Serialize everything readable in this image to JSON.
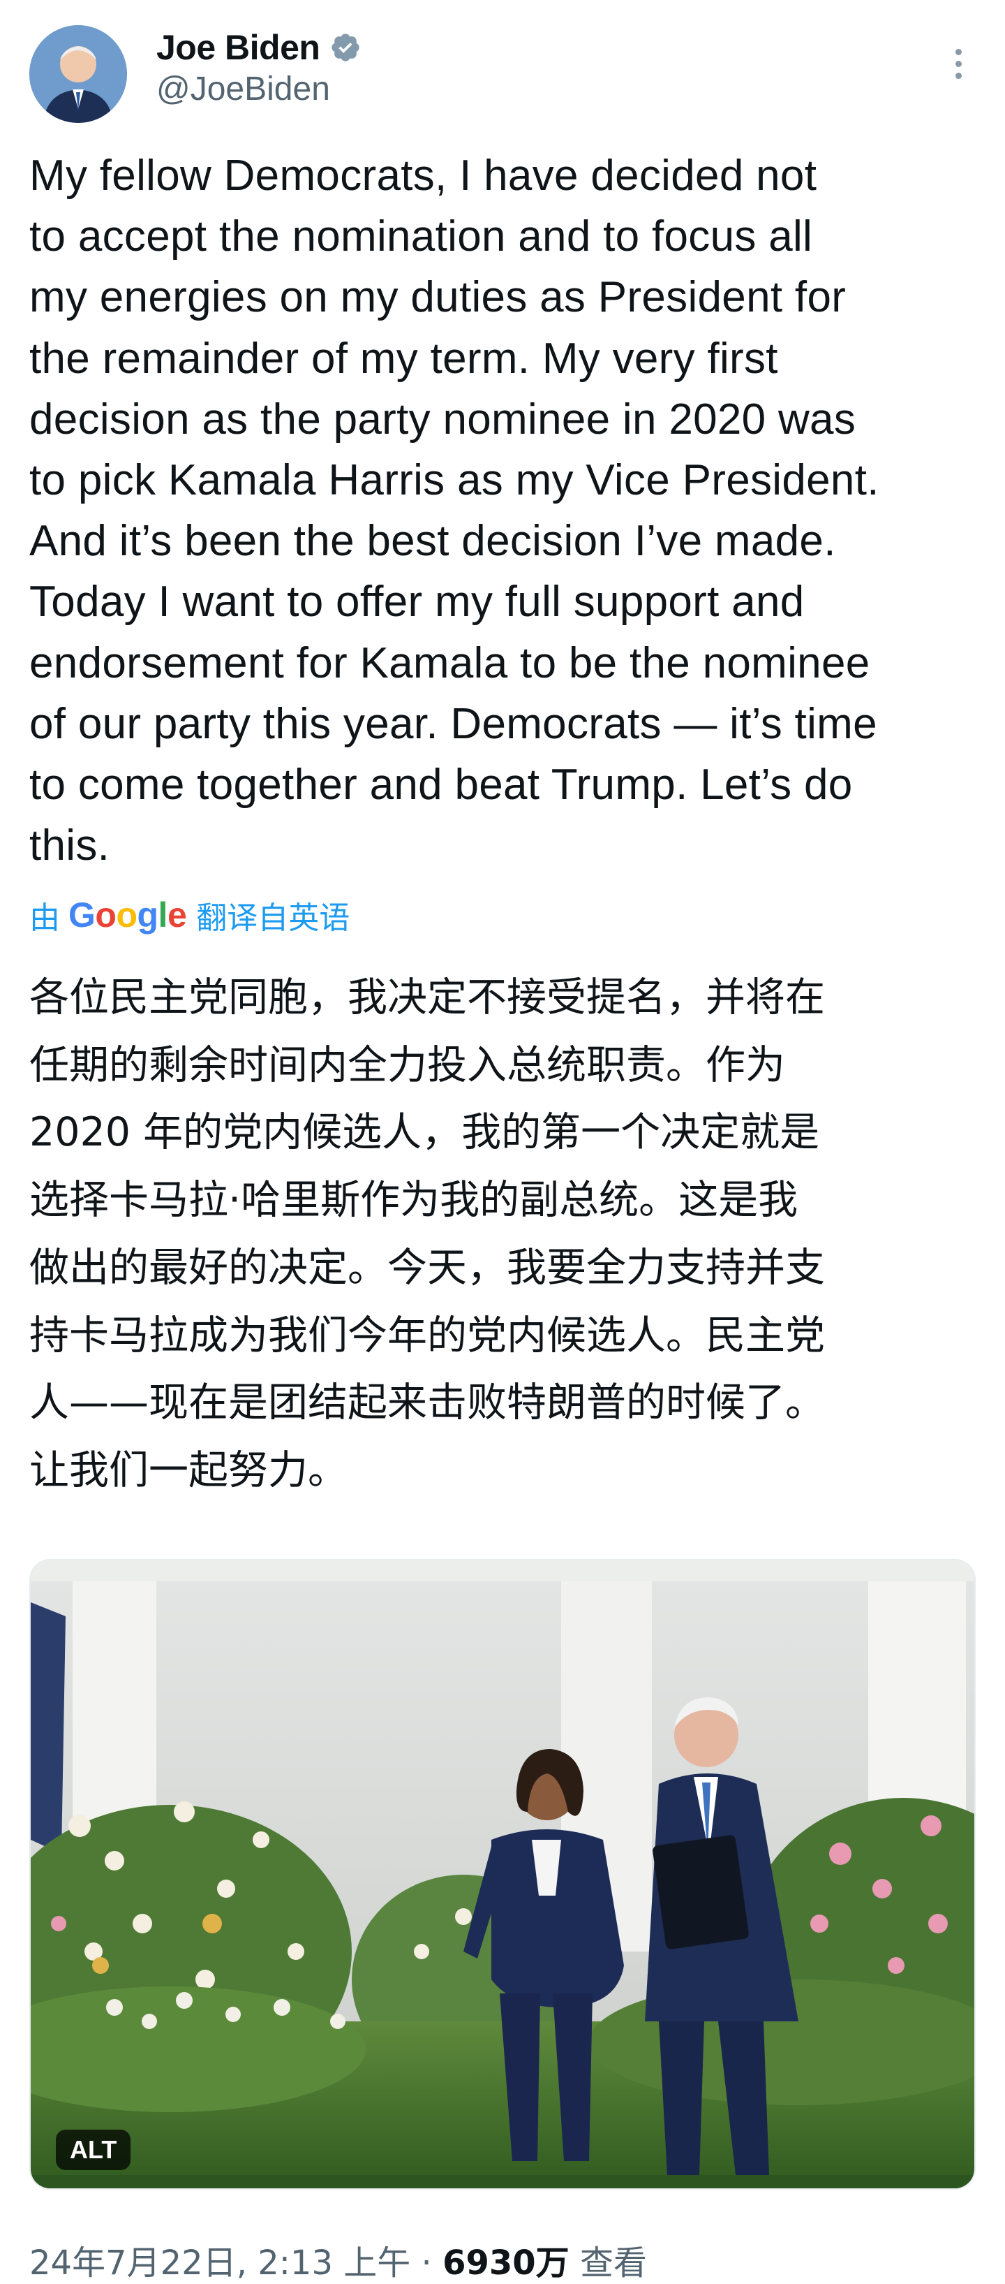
{
  "author": {
    "display_name": "Joe Biden",
    "handle": "@JoeBiden",
    "verified_icon": "verified-badge-icon",
    "avatar": "avatar-photo"
  },
  "tweet": {
    "text": "My fellow Democrats, I have decided not\nto accept the nomination and to focus all\nmy energies on my duties as President for\nthe remainder of my term. My very first\ndecision as the party nominee in 2020 was\nto pick Kamala Harris as my Vice President.\nAnd it’s been the best decision I’ve made.\nToday I want to offer my full support and\nendorsement for Kamala to be the nominee\nof our party this year. Democrats — it’s time\nto come together and beat Trump. Let’s do\nthis.",
    "translated_prefix": "由",
    "translator": "Google",
    "translated_suffix": "翻译自英语",
    "translation": "各位民主党同胞，我决定不接受提名，并将在\n任期的剩余时间内全力投入总统职责。作为\n2020 年的党内候选人，我的第一个决定就是\n选择卡马拉·哈里斯作为我的副总统。这是我\n做出的最好的决定。今天，我要全力支持并支\n持卡马拉成为我们今年的党内候选人。民主党\n人——现在是团结起来击败特朗普的时候了。\n让我们一起努力。",
    "media_alt_label": "ALT"
  },
  "meta": {
    "timestamp": "24年7月22日, 2:13 上午",
    "separator": "·",
    "views": "6930万",
    "views_label": "查看"
  },
  "colors": {
    "link": "#1d9bf0",
    "muted": "#536471",
    "text": "#0f1419"
  },
  "icons": {
    "more": "more-options-icon"
  }
}
